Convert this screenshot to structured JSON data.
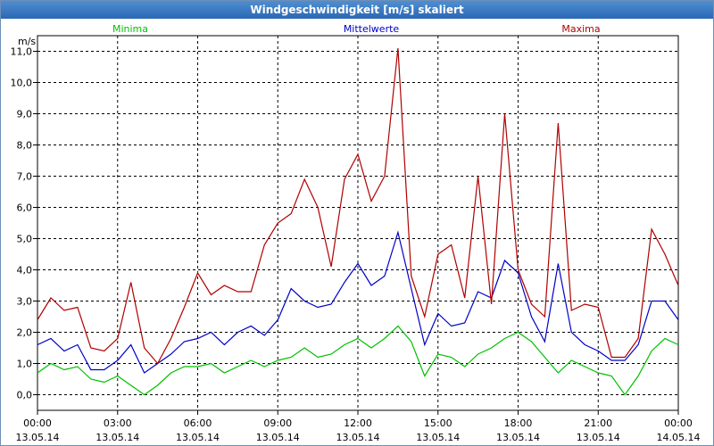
{
  "window": {
    "title": "Windgeschwindigkeit [m/s] skaliert"
  },
  "chart_data": {
    "type": "line",
    "ylabel": "m/s",
    "ylim": [
      -0.5,
      11.5
    ],
    "xlim": [
      0,
      24
    ],
    "grid": true,
    "legend": "top",
    "y_ticks": [
      "0,0",
      "1,0",
      "2,0",
      "3,0",
      "4,0",
      "5,0",
      "6,0",
      "7,0",
      "8,0",
      "9,0",
      "10,0",
      "11,0"
    ],
    "x_ticks": [
      {
        "time": "00:00",
        "date": "13.05.14"
      },
      {
        "time": "03:00",
        "date": "13.05.14"
      },
      {
        "time": "06:00",
        "date": "13.05.14"
      },
      {
        "time": "09:00",
        "date": "13.05.14"
      },
      {
        "time": "12:00",
        "date": "13.05.14"
      },
      {
        "time": "15:00",
        "date": "13.05.14"
      },
      {
        "time": "18:00",
        "date": "13.05.14"
      },
      {
        "time": "21:00",
        "date": "13.05.14"
      },
      {
        "time": "00:00",
        "date": "14.05.14"
      }
    ],
    "x_hours": [
      0,
      0.5,
      1,
      1.5,
      2,
      2.5,
      3,
      3.5,
      4,
      4.5,
      5,
      5.5,
      6,
      6.5,
      7,
      7.5,
      8,
      8.5,
      9,
      9.5,
      10,
      10.5,
      11,
      11.5,
      12,
      12.5,
      13,
      13.5,
      14,
      14.5,
      15,
      15.5,
      16,
      16.5,
      17,
      17.5,
      18,
      18.5,
      19,
      19.5,
      20,
      20.5,
      21,
      21.5,
      22,
      22.5,
      23,
      23.5,
      24
    ],
    "series": [
      {
        "name": "Minima",
        "color": "#00c000",
        "values": [
          0.7,
          1.0,
          0.8,
          0.9,
          0.5,
          0.4,
          0.6,
          0.3,
          0.0,
          0.3,
          0.7,
          0.9,
          0.9,
          1.0,
          0.7,
          0.9,
          1.1,
          0.9,
          1.1,
          1.2,
          1.5,
          1.2,
          1.3,
          1.6,
          1.8,
          1.5,
          1.8,
          2.2,
          1.7,
          0.6,
          1.3,
          1.2,
          0.9,
          1.3,
          1.5,
          1.8,
          2.0,
          1.7,
          1.2,
          0.7,
          1.1,
          0.9,
          0.7,
          0.6,
          0.0,
          0.6,
          1.4,
          1.8,
          1.6
        ]
      },
      {
        "name": "Mittelwerte",
        "color": "#0000c8",
        "values": [
          1.6,
          1.8,
          1.4,
          1.6,
          0.8,
          0.8,
          1.1,
          1.6,
          0.7,
          1.0,
          1.3,
          1.7,
          1.8,
          2.0,
          1.6,
          2.0,
          2.2,
          1.9,
          2.4,
          3.4,
          3.0,
          2.8,
          2.9,
          3.6,
          4.2,
          3.5,
          3.8,
          5.2,
          3.4,
          1.6,
          2.6,
          2.2,
          2.3,
          3.3,
          3.1,
          4.3,
          3.9,
          2.5,
          1.7,
          4.2,
          2.0,
          1.6,
          1.4,
          1.1,
          1.1,
          1.6,
          3.0,
          3.0,
          2.4
        ]
      },
      {
        "name": "Maxima",
        "color": "#b00000",
        "values": [
          2.4,
          3.1,
          2.7,
          2.8,
          1.5,
          1.4,
          1.8,
          3.6,
          1.5,
          1.0,
          1.8,
          2.8,
          3.9,
          3.2,
          3.5,
          3.3,
          3.3,
          4.8,
          5.5,
          5.8,
          6.9,
          6.0,
          4.1,
          6.9,
          7.7,
          6.2,
          7.0,
          11.1,
          3.8,
          2.5,
          4.5,
          4.8,
          3.1,
          7.0,
          2.9,
          9.0,
          4.0,
          2.9,
          2.5,
          8.7,
          2.7,
          2.9,
          2.8,
          1.2,
          1.2,
          1.8,
          5.3,
          4.5,
          3.5
        ]
      }
    ]
  }
}
